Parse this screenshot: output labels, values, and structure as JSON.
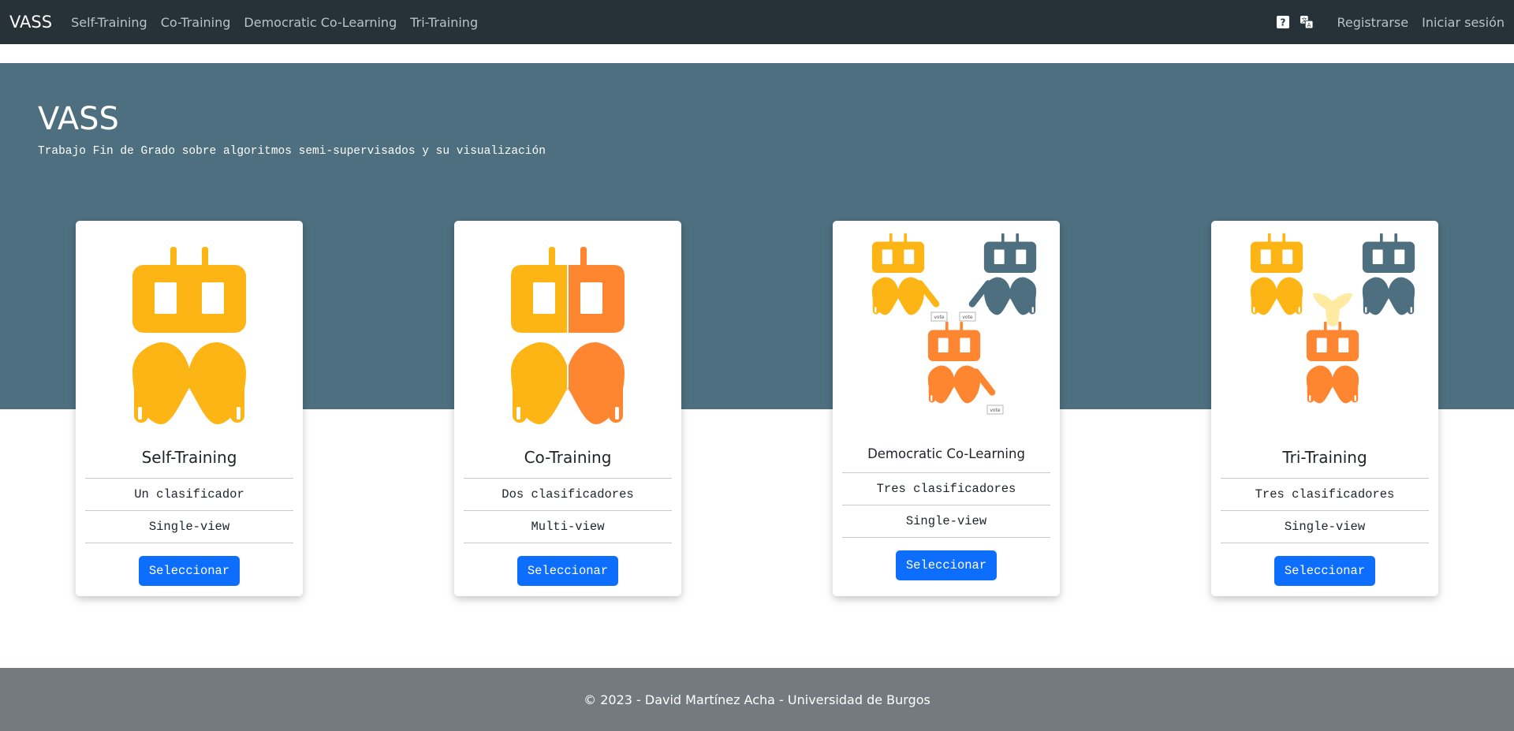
{
  "navbar": {
    "brand": "VASS",
    "links": [
      "Self-Training",
      "Co-Training",
      "Democratic Co-Learning",
      "Tri-Training"
    ],
    "help_icon": "help-icon",
    "translate_icon": "translate-icon",
    "register": "Registrarse",
    "login": "Iniciar sesión"
  },
  "hero": {
    "title": "VASS",
    "subtitle": "Trabajo Fin de Grado sobre algoritmos semi-supervisados y su visualización"
  },
  "cards": [
    {
      "title": "Self-Training",
      "classifiers": "Un clasificador",
      "view": "Single-view",
      "button": "Seleccionar"
    },
    {
      "title": "Co-Training",
      "classifiers": "Dos clasificadores",
      "view": "Multi-view",
      "button": "Seleccionar"
    },
    {
      "title": "Democratic Co-Learning",
      "classifiers": "Tres clasificadores",
      "view": "Single-view",
      "button": "Seleccionar"
    },
    {
      "title": "Tri-Training",
      "classifiers": "Tres clasificadores",
      "view": "Single-view",
      "button": "Seleccionar"
    }
  ],
  "vote_label": "vote",
  "footer": {
    "text": "© 2023 - David Martínez Acha - Universidad de Burgos"
  },
  "colors": {
    "yellow": "#fdb515",
    "orange": "#fe8630",
    "slate": "#4d6f7f",
    "navbar": "#263238",
    "hero": "#4d6f7f",
    "button": "#0d6efd",
    "footer": "#737a80"
  }
}
